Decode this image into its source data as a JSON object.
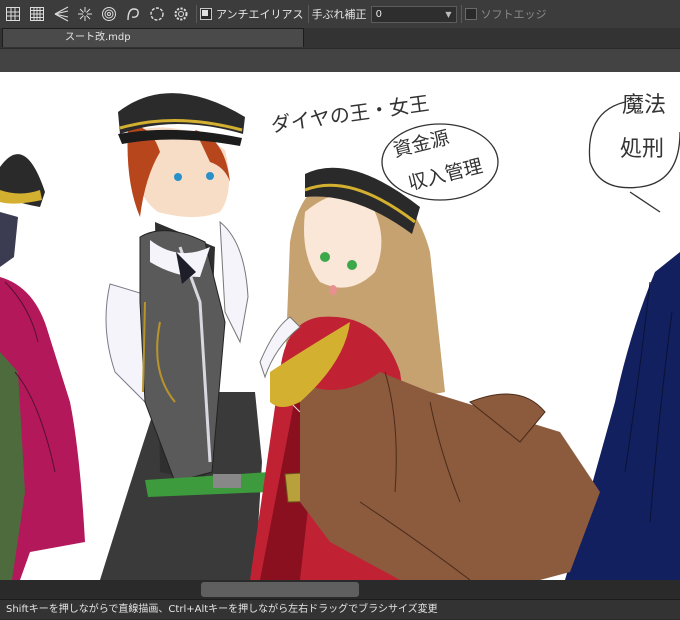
{
  "toolbar": {
    "tools": [
      "grid-icon",
      "perspective-icon",
      "radial-line-icon",
      "concentric-circle-icon",
      "curve-icon",
      "circle-icon",
      "gear-icon"
    ],
    "antialias_label": "アンチエイリアス",
    "antialias_checked": true,
    "stabilizer_label": "手ぶれ補正",
    "stabilizer_value": "0",
    "soft_edge_label": "ソフトエッジ",
    "soft_edge_checked": false
  },
  "tabs": [
    {
      "label": "スート改.mdp"
    }
  ],
  "canvas": {
    "handwriting": {
      "top": "ダイヤの王・女王",
      "circle1_line1": "資金源",
      "circle1_line2": "収入管理",
      "right_line1": "魔法",
      "right_line2": "処刑"
    }
  },
  "status": "Shiftキーを押しながらで直線描画、Ctrl+Altキーを押しながら左右ドラッグでブラシサイズ変更"
}
